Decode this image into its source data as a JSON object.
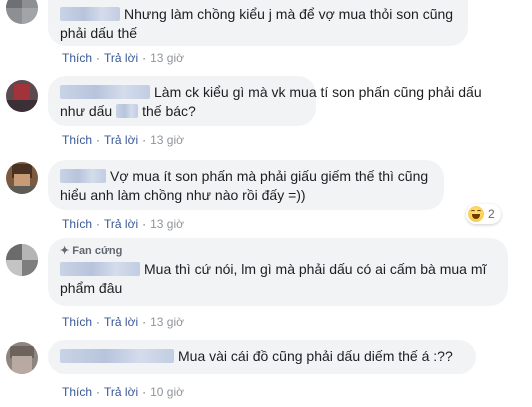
{
  "comments": [
    {
      "text": "Nhưng làm chồng kiểu j mà để vợ mua thỏi son cũng phải dấu thế",
      "like": "Thích",
      "reply": "Trả lời",
      "time": "13 giờ"
    },
    {
      "text_a": "Làm ck kiểu gì mà vk mua tí son phấn cũng phải dấu",
      "text_b": "như dấu",
      "text_c": "thế bác?",
      "like": "Thích",
      "reply": "Trả lời",
      "time": "13 giờ"
    },
    {
      "text": "Vợ mua ít son phấn mà phải giấu giếm thế thì cũng hiểu anh làm chồng như nào rồi đấy =))",
      "like": "Thích",
      "reply": "Trả lời",
      "time": "13 giờ",
      "reaction_icon": "haha-emoji-icon",
      "reaction_count": "2"
    },
    {
      "badge": "Fan cứng",
      "text_a": "Mua thì cứ nói, lm gì mà phải dấu có ai cấm bà mua mĩ",
      "text_b": "phẩm đâu",
      "like": "Thích",
      "reply": "Trả lời",
      "time": "13 giờ"
    },
    {
      "text": "Mua vài cái đồ cũng phải dấu diếm thế á :??",
      "like": "Thích",
      "reply": "Trả lời",
      "time": "10 giờ"
    }
  ],
  "colors": {
    "bubble": "#f2f3f5",
    "link": "#385898",
    "time": "#90949c"
  }
}
